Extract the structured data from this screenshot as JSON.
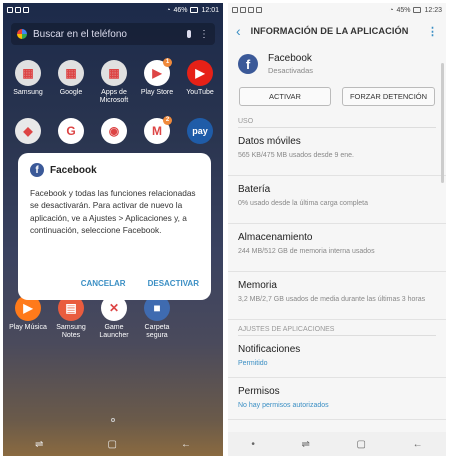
{
  "left": {
    "status": {
      "time": "12:01",
      "battery": "46%"
    },
    "search": {
      "placeholder": "Buscar en el teléfono"
    },
    "apps": [
      {
        "label": "Samsung",
        "icon": "samsung-folder-icon",
        "color": "#e0e0e0",
        "glyph": "▦"
      },
      {
        "label": "Google",
        "icon": "google-folder-icon",
        "color": "#e0e0e0",
        "glyph": "▦"
      },
      {
        "label": "Apps de Microsoft",
        "icon": "microsoft-folder-icon",
        "color": "#e0e0e0",
        "glyph": "▦"
      },
      {
        "label": "Play Store",
        "icon": "play-store-icon",
        "color": "#ffffff",
        "glyph": "▶",
        "badge": "1"
      },
      {
        "label": "YouTube",
        "icon": "youtube-icon",
        "color": "#e62117",
        "glyph": "▶"
      },
      {
        "label": "",
        "icon": "maps-icon",
        "color": "#e8e8e8",
        "glyph": "◆"
      },
      {
        "label": "",
        "icon": "google-search-icon",
        "color": "#ffffff",
        "glyph": "G"
      },
      {
        "label": "",
        "icon": "chrome-icon",
        "color": "#ffffff",
        "glyph": "◉"
      },
      {
        "label": "",
        "icon": "gmail-icon",
        "color": "#ffffff",
        "glyph": "M",
        "badge": "2"
      },
      {
        "label": "",
        "icon": "samsung-pay-icon",
        "color": "#1f5ca8",
        "glyph": "pay"
      },
      {
        "label": "Play Música",
        "icon": "play-music-icon",
        "color": "#ff7a1a",
        "glyph": "▶"
      },
      {
        "label": "Samsung Notes",
        "icon": "samsung-notes-icon",
        "color": "#e95c3e",
        "glyph": "▤"
      },
      {
        "label": "Game Launcher",
        "icon": "game-launcher-icon",
        "color": "#ffffff",
        "glyph": "✕"
      },
      {
        "label": "Carpeta segura",
        "icon": "secure-folder-icon",
        "color": "#3f6bb0",
        "glyph": "■"
      }
    ],
    "dialog": {
      "title": "Facebook",
      "body": "Facebook y todas las funciones relacionadas se desactivarán. Para activar de nuevo la aplicación, ve a Ajustes > Aplicaciones y, a continuación, seleccione Facebook.",
      "cancel": "CANCELAR",
      "confirm": "DESACTIVAR"
    }
  },
  "right": {
    "status": {
      "time": "12:23",
      "battery": "45%"
    },
    "appbar": {
      "title": "INFORMACIÓN DE LA APLICACIÓN"
    },
    "app": {
      "name": "Facebook",
      "status": "Desactivadas"
    },
    "buttons": {
      "activate": "ACTIVAR",
      "force_stop": "FORZAR DETENCIÓN"
    },
    "section_uso": "USO",
    "items": [
      {
        "title": "Datos móviles",
        "sub": "565 KB/475 MB usados desde 9 ene."
      },
      {
        "title": "Batería",
        "sub": "0% usado desde la última carga completa"
      },
      {
        "title": "Almacenamiento",
        "sub": "244 MB/512 GB de memoria interna usados"
      },
      {
        "title": "Memoria",
        "sub": "3,2 MB/2,7 GB usados de media durante las últimas 3 horas"
      }
    ],
    "section_ajustes": "AJUSTES DE APLICACIONES",
    "settings": [
      {
        "title": "Notificaciones",
        "sub": "Permitido"
      },
      {
        "title": "Permisos",
        "sub": "No hay permisos autorizados"
      }
    ]
  },
  "colors": {
    "accent": "#3b8fc4",
    "facebook": "#3b5998"
  }
}
